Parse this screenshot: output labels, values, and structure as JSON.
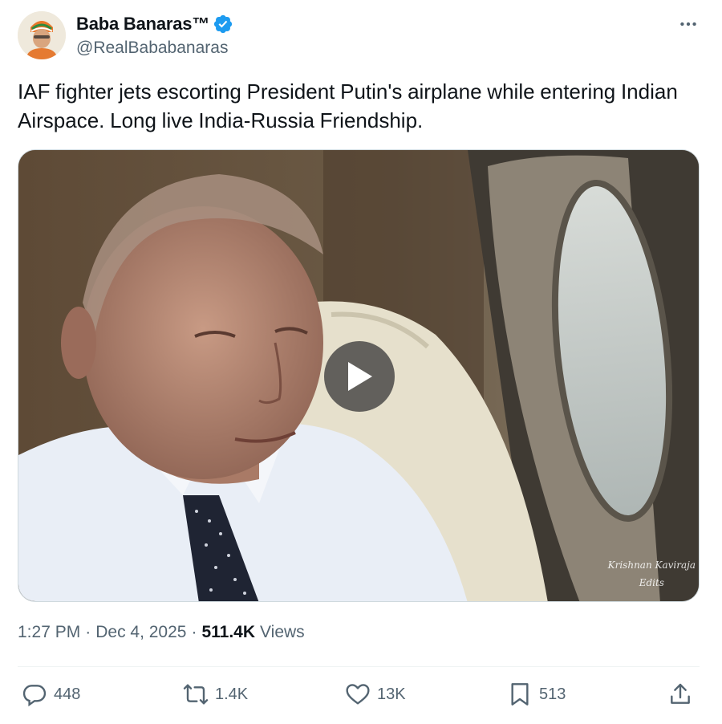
{
  "author": {
    "display_name": "Baba Banaras™",
    "handle": "@RealBababanaras",
    "verified_color": "#1d9bf0"
  },
  "tweet": {
    "text": "IAF fighter jets escorting President Putin's airplane while entering Indian Airspace. Long live India-Russia Friendship."
  },
  "media": {
    "type": "video",
    "watermark_line1": "Krishnan Kaviraja",
    "watermark_line2": "Edits"
  },
  "meta": {
    "time": "1:27 PM",
    "separator": "·",
    "date": "Dec 4, 2025",
    "views_count": "511.4K",
    "views_label": "Views"
  },
  "actions": {
    "replies": "448",
    "reposts": "1.4K",
    "likes": "13K",
    "bookmarks": "513"
  },
  "icons": {
    "more": "more-horizontal-icon",
    "reply": "reply-icon",
    "repost": "repost-icon",
    "like": "heart-icon",
    "bookmark": "bookmark-icon",
    "share": "share-icon",
    "play": "play-icon",
    "verified": "verified-badge-icon"
  },
  "colors": {
    "text_primary": "#0f1419",
    "text_secondary": "#536471",
    "divider": "#eff3f4"
  }
}
